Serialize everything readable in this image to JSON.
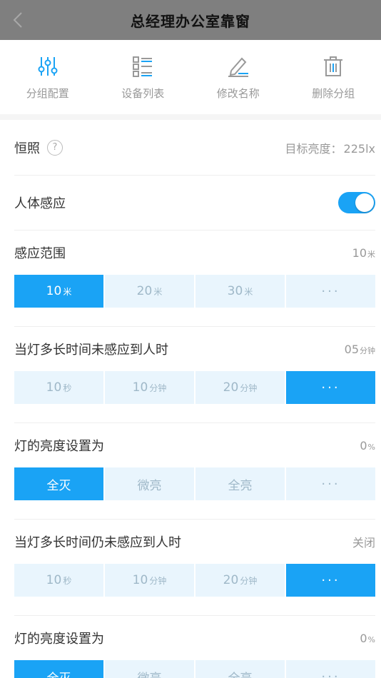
{
  "nav": {
    "title": "总经理办公室靠窗",
    "back_icon": "chevron-left-icon"
  },
  "toolbar": {
    "items": [
      {
        "label": "分组配置",
        "icon": "sliders-icon",
        "active": true
      },
      {
        "label": "设备列表",
        "icon": "list-icon",
        "active": false
      },
      {
        "label": "修改名称",
        "icon": "edit-icon",
        "active": false
      },
      {
        "label": "删除分组",
        "icon": "trash-icon",
        "active": false
      }
    ]
  },
  "constant": {
    "label": "恒照",
    "help": "?",
    "target_label": "目标亮度：",
    "target_value": "225lx"
  },
  "human": {
    "label": "人体感应",
    "enabled": true
  },
  "range": {
    "title": "感应范围",
    "value": "10",
    "unit": "米",
    "options": [
      {
        "num": "10",
        "unit": "米",
        "selected": true
      },
      {
        "num": "20",
        "unit": "米",
        "selected": false
      },
      {
        "num": "30",
        "unit": "米",
        "selected": false
      },
      {
        "num": "···",
        "unit": "",
        "selected": false
      }
    ]
  },
  "time1": {
    "title": "当灯多长时间未感应到人时",
    "value": "05",
    "unit": "分钟",
    "options": [
      {
        "num": "10",
        "unit": "秒",
        "selected": false
      },
      {
        "num": "10",
        "unit": "分钟",
        "selected": false
      },
      {
        "num": "20",
        "unit": "分钟",
        "selected": false
      },
      {
        "num": "···",
        "unit": "",
        "selected": true
      }
    ]
  },
  "bright1": {
    "title": "灯的亮度设置为",
    "value": "0",
    "unit": "%",
    "options": [
      {
        "num": "全灭",
        "unit": "",
        "selected": true
      },
      {
        "num": "微亮",
        "unit": "",
        "selected": false
      },
      {
        "num": "全亮",
        "unit": "",
        "selected": false
      },
      {
        "num": "···",
        "unit": "",
        "selected": false
      }
    ]
  },
  "time2": {
    "title": "当灯多长时间仍未感应到人时",
    "value": "关闭",
    "unit": "",
    "options": [
      {
        "num": "10",
        "unit": "秒",
        "selected": false
      },
      {
        "num": "10",
        "unit": "分钟",
        "selected": false
      },
      {
        "num": "20",
        "unit": "分钟",
        "selected": false
      },
      {
        "num": "···",
        "unit": "",
        "selected": true
      }
    ]
  },
  "bright2": {
    "title": "灯的亮度设置为",
    "value": "0",
    "unit": "%",
    "options": [
      {
        "num": "全灭",
        "unit": "",
        "selected": true
      },
      {
        "num": "微亮",
        "unit": "",
        "selected": false
      },
      {
        "num": "全亮",
        "unit": "",
        "selected": false
      },
      {
        "num": "···",
        "unit": "",
        "selected": false
      }
    ]
  },
  "colors": {
    "accent": "#1aa3f5",
    "option_bg": "#e9f5fd",
    "nav_bg": "#7f7f7f"
  }
}
